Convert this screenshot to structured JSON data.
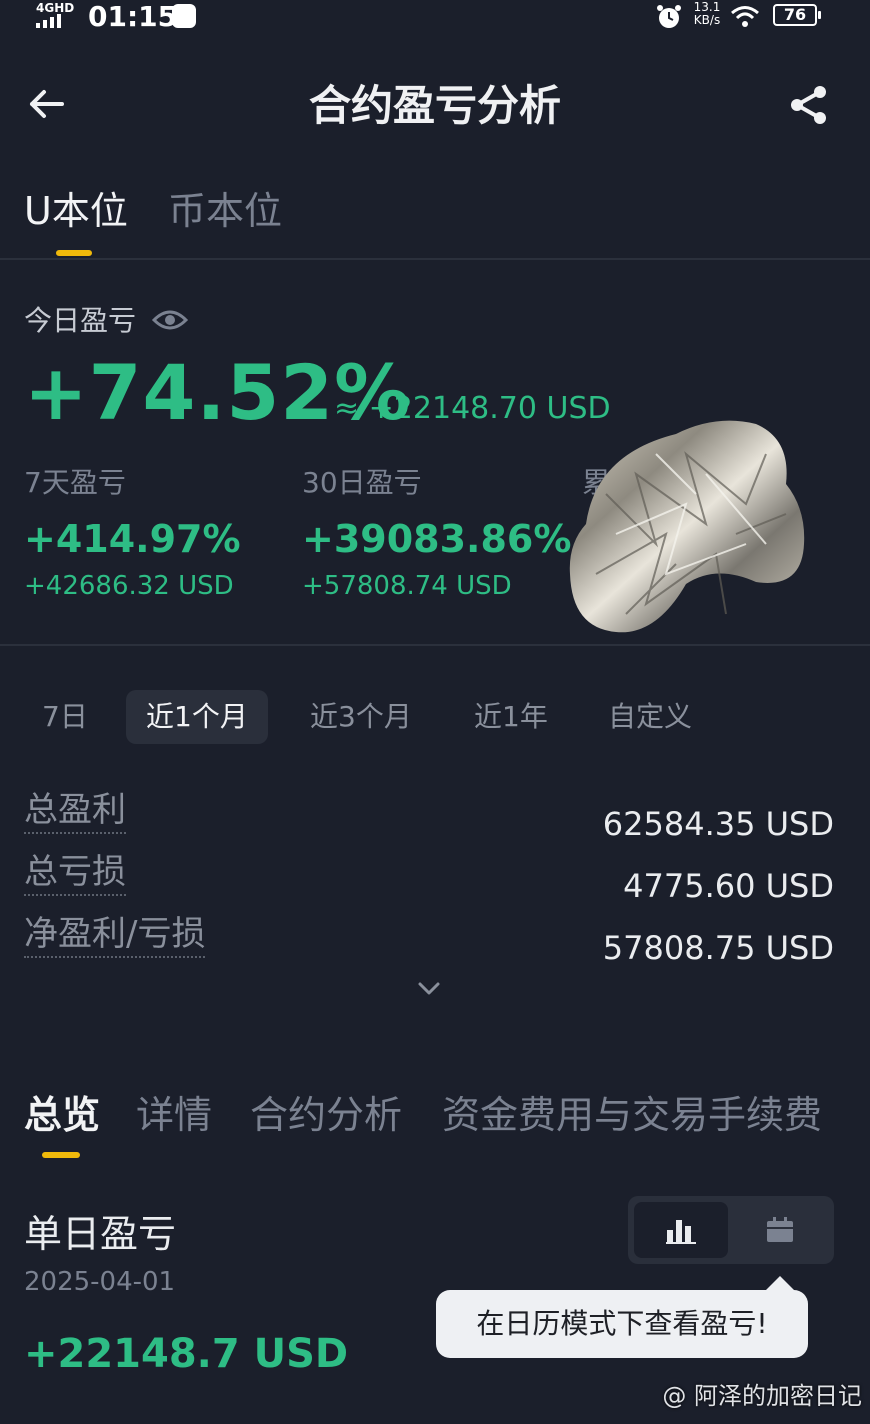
{
  "status_bar": {
    "network": "4GHD",
    "time": "01:15",
    "speed_value": "13.1",
    "speed_unit": "KB/s",
    "battery": "76"
  },
  "header": {
    "title": "合约盈亏分析"
  },
  "unit_tabs": [
    {
      "label": "U本位",
      "active": true
    },
    {
      "label": "币本位",
      "active": false
    }
  ],
  "today": {
    "label": "今日盈亏",
    "percent": "+74.52%",
    "usd": "≈ +22148.70 USD"
  },
  "stats": [
    {
      "label": "7天盈亏",
      "percent": "+414.97%",
      "usd": "+42686.32 USD"
    },
    {
      "label": "30日盈亏",
      "percent": "+39083.86%",
      "usd": "+57808.74 USD"
    },
    {
      "label": "累"
    }
  ],
  "period_tabs": [
    {
      "label": "7日",
      "active": false
    },
    {
      "label": "近1个月",
      "active": true
    },
    {
      "label": "近3个月",
      "active": false
    },
    {
      "label": "近1年",
      "active": false
    },
    {
      "label": "自定义",
      "active": false
    }
  ],
  "summary": [
    {
      "label": "总盈利",
      "value": "62584.35 USD"
    },
    {
      "label": "总亏损",
      "value": "4775.60 USD"
    },
    {
      "label": "净盈利/亏损",
      "value": "57808.75 USD"
    }
  ],
  "section_tabs": [
    {
      "label": "总览",
      "active": true
    },
    {
      "label": "详情",
      "active": false
    },
    {
      "label": "合约分析",
      "active": false
    },
    {
      "label": "资金费用与交易手续费",
      "active": false
    }
  ],
  "daily": {
    "title": "单日盈亏",
    "date": "2025-04-01",
    "value": "+22148.7 USD"
  },
  "tooltip": {
    "text": "在日历模式下查看盈亏!"
  },
  "watermark": "@ 阿泽的加密日记",
  "colors": {
    "background": "#1b1f2b",
    "profit_green": "#2ebd85",
    "accent_yellow": "#f0b90b"
  },
  "icons": [
    "back-arrow-icon",
    "share-icon",
    "eye-icon",
    "chevron-down-icon",
    "bar-chart-icon",
    "calendar-icon"
  ]
}
